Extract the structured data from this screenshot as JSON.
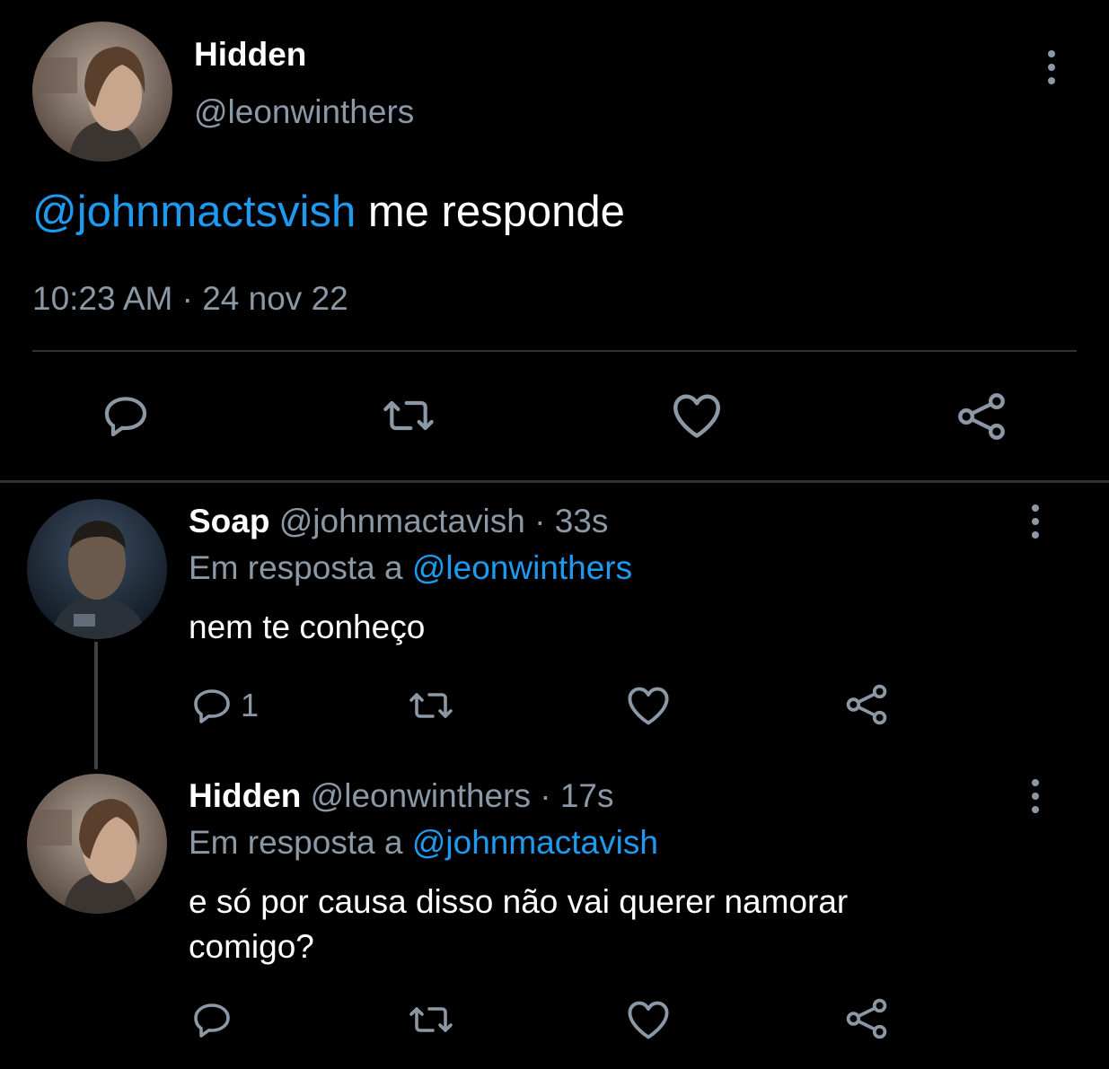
{
  "main_tweet": {
    "name": "Hidden",
    "handle": "@leonwinthers",
    "mention": "@johnmactsvish",
    "text": " me responde",
    "timestamp": "10:23 AM · 24 nov 22",
    "avatar_icon": "avatar-photo"
  },
  "reply1": {
    "name": "Soap",
    "handle": "@johnmactavish",
    "time": "· 33s",
    "replying_prefix": "Em resposta a",
    "replying_to": "@leonwinthers",
    "text": "nem te conheço",
    "reply_count": "1"
  },
  "reply2": {
    "name": "Hidden",
    "handle": "@leonwinthers",
    "time": "· 17s",
    "replying_prefix": "Em resposta a",
    "replying_to": "@johnmactavish",
    "text_line1": "e só por causa disso não vai querer namorar",
    "text_line2": "comigo?"
  },
  "icons": {
    "reply": "reply-icon",
    "retweet": "retweet-icon",
    "like": "heart-icon",
    "share": "share-icon",
    "more": "more-vertical-icon"
  },
  "colors": {
    "background": "#000000",
    "link": "#1d9bf0",
    "muted": "#8b98a5",
    "divider": "#2f3336"
  }
}
